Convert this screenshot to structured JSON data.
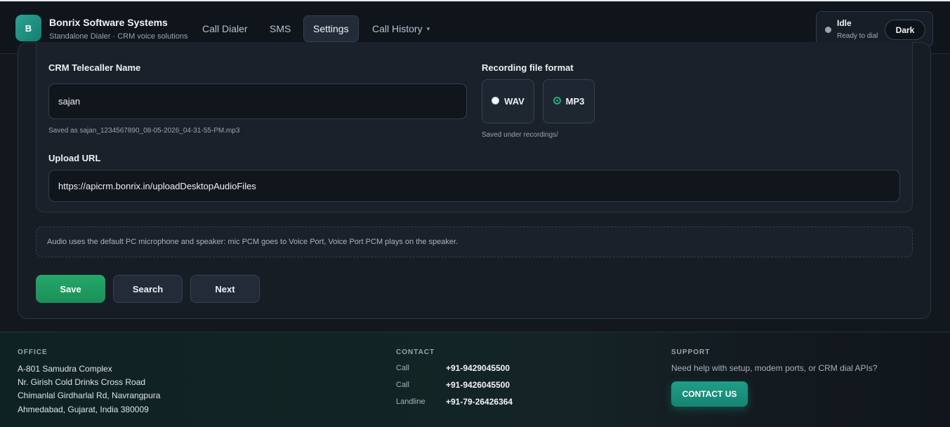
{
  "header": {
    "logo_letter": "B",
    "brand_title": "Bonrix Software Systems",
    "brand_subtitle": "Standalone Dialer · CRM voice solutions",
    "nav": [
      {
        "label": "Call Dialer"
      },
      {
        "label": "SMS"
      },
      {
        "label": "Settings",
        "active": true
      },
      {
        "label": "Call History",
        "dropdown": true
      }
    ],
    "status_title": "Idle",
    "status_subtitle": "Ready to dial",
    "theme_label": "Dark"
  },
  "settings": {
    "telecaller_label": "CRM Telecaller Name",
    "telecaller_value": "sajan",
    "telecaller_hint": "Saved as sajan_1234567890_08-05-2026_04-31-55-PM.mp3",
    "format_label": "Recording file format",
    "format_options": [
      {
        "label": "WAV",
        "checked": false
      },
      {
        "label": "MP3",
        "checked": true
      }
    ],
    "format_hint": "Saved under recordings/",
    "upload_label": "Upload URL",
    "upload_value": "https://apicrm.bonrix.in/uploadDesktopAudioFiles",
    "audio_note": "Audio uses the default PC microphone and speaker: mic PCM goes to Voice Port, Voice Port PCM plays on the speaker."
  },
  "actions": {
    "save": "Save",
    "search": "Search",
    "next": "Next"
  },
  "footer": {
    "office_heading": "OFFICE",
    "office_lines": [
      "A-801 Samudra Complex",
      "Nr. Girish Cold Drinks Cross Road",
      "Chimanlal Girdharlal Rd, Navrangpura",
      "Ahmedabad, Gujarat, India 380009"
    ],
    "contact_heading": "CONTACT",
    "contacts": [
      {
        "key": "Call",
        "value": "+91-9429045500"
      },
      {
        "key": "Call",
        "value": "+91-9426045500"
      },
      {
        "key": "Landline",
        "value": "+91-79-26426364"
      }
    ],
    "support_heading": "SUPPORT",
    "support_text": "Need help with setup, modem ports, or CRM dial APIs?",
    "contact_button": "CONTACT US"
  },
  "colors": {
    "accent": "#23b17e",
    "primary_button": "#1f9c63",
    "contact_button": "#1f9e86",
    "background": "#13181f"
  }
}
